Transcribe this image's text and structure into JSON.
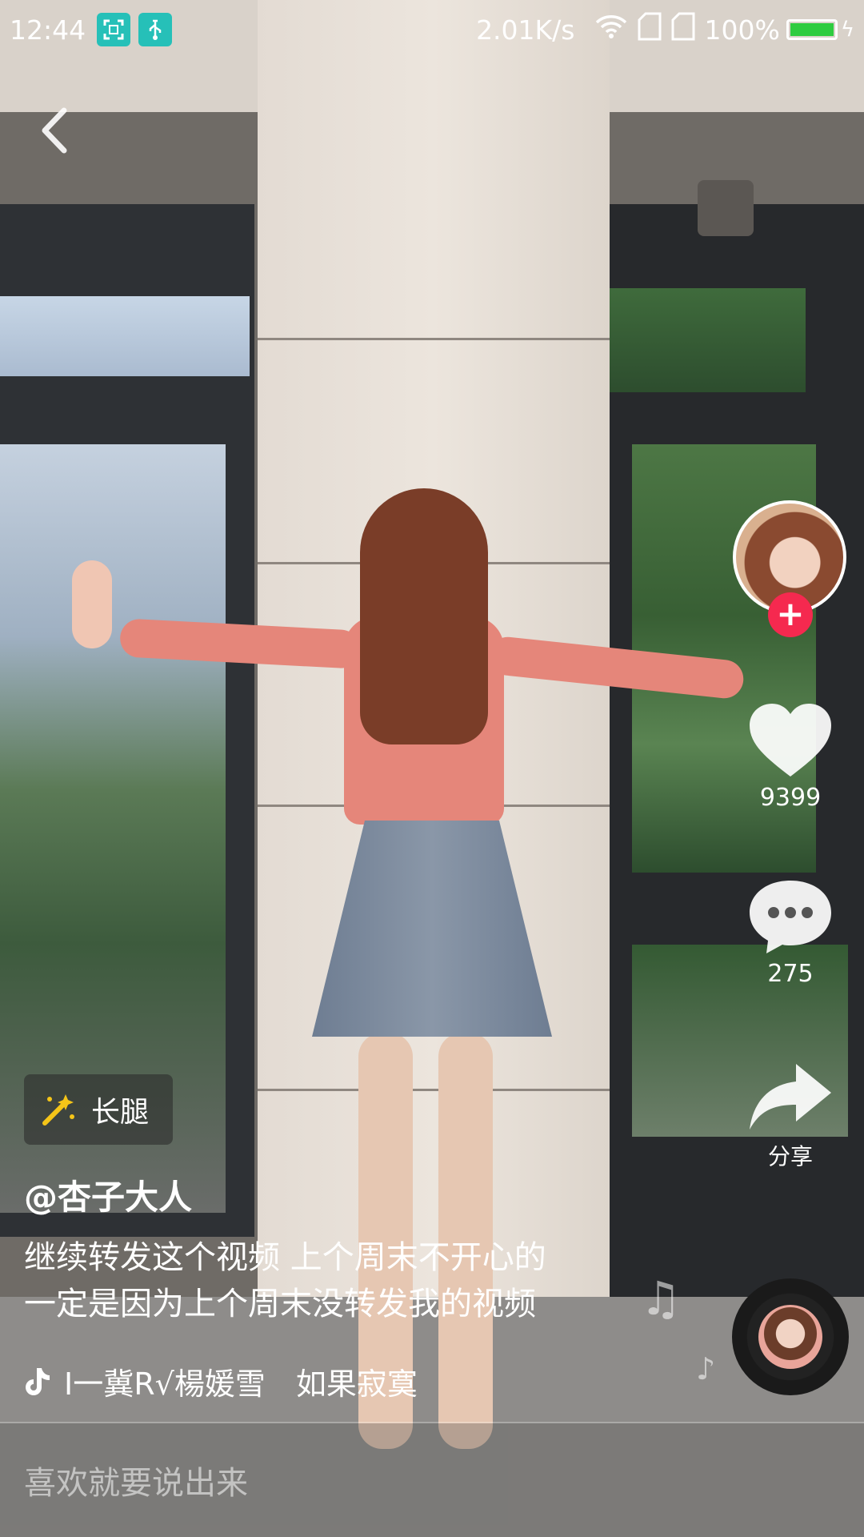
{
  "status_bar": {
    "time": "12:44",
    "net_speed": "2.01K/s",
    "battery": "100%",
    "battery_level": 1.0,
    "icons": [
      "screenshot-icon",
      "usb-icon",
      "wifi-icon",
      "sim1-icon",
      "sim2-icon",
      "battery-icon",
      "charging-icon"
    ]
  },
  "video": {
    "effect_tag": "长腿",
    "username": "@杏子大人",
    "caption_lines": [
      "继续转发这个视频 上个周末不开心的",
      "一定是因为上个周末没转发我的视频"
    ],
    "music": "I一冀R√楊媛雪　如果寂寞"
  },
  "rail": {
    "likes": "9399",
    "comments": "275",
    "share_label": "分享",
    "follow_symbol": "+"
  },
  "comment_bar": {
    "placeholder": "喜欢就要说出来"
  },
  "colors": {
    "follow": "#f5294f",
    "status_app": "#26c0b8",
    "battery_fill": "#2ecc40"
  }
}
